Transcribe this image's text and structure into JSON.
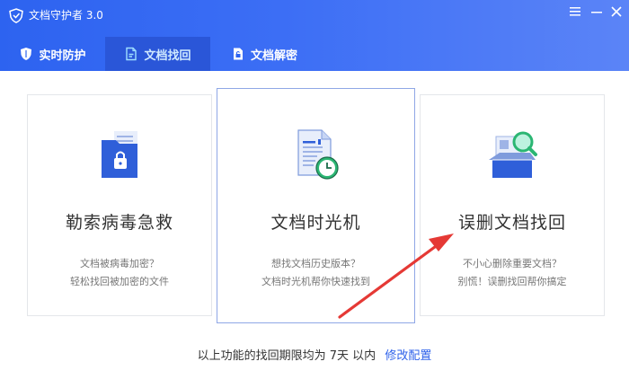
{
  "app": {
    "title": "文档守护者 3.0"
  },
  "tabs": [
    {
      "label": "实时防护",
      "icon": "shield-icon"
    },
    {
      "label": "文档找回",
      "icon": "document-recover-icon",
      "active": true
    },
    {
      "label": "文档解密",
      "icon": "unlock-icon"
    }
  ],
  "cards": [
    {
      "title": "勒索病毒急救",
      "desc1": "文档被病毒加密？",
      "desc2": "轻松找回被加密的文件",
      "icon": "locked-folder-icon"
    },
    {
      "title": "文档时光机",
      "desc1": "想找文档历史版本？",
      "desc2": "文档时光机帮你快速找到",
      "icon": "document-clock-icon"
    },
    {
      "title": "误删文档找回",
      "desc1": "不小心删除重要文档？",
      "desc2": "别慌！误删找回帮你搞定",
      "icon": "box-search-icon"
    }
  ],
  "footer": {
    "text": "以上功能的找回期限均为 7天 以内",
    "link": "修改配置"
  },
  "colors": {
    "header_start": "#2d63f0",
    "header_end": "#5b84f7",
    "active_tab": "#2a56d8",
    "link": "#2f62ea",
    "arrow": "#e53935"
  }
}
